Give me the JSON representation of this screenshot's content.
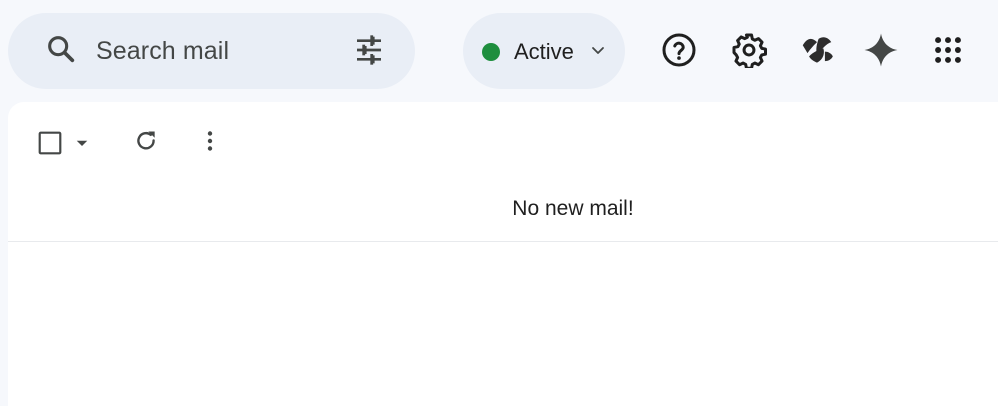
{
  "search": {
    "placeholder": "Search mail",
    "icon": "search-icon",
    "filter_icon": "tune-icon"
  },
  "status": {
    "label": "Active",
    "dot_color": "#1e8e3e"
  },
  "header_icons": [
    "help-icon",
    "gear-icon",
    "gemini-sparkle-icon",
    "apps-grid-icon"
  ],
  "toolbar": {
    "icons": [
      "select-checkbox",
      "select-dropdown-icon",
      "refresh-icon",
      "more-vert-icon"
    ]
  },
  "mail_list": {
    "empty_message": "No new mail!"
  },
  "colors": {
    "background": "#f6f8fc",
    "pill": "#e9eef6",
    "icon": "#444746"
  }
}
